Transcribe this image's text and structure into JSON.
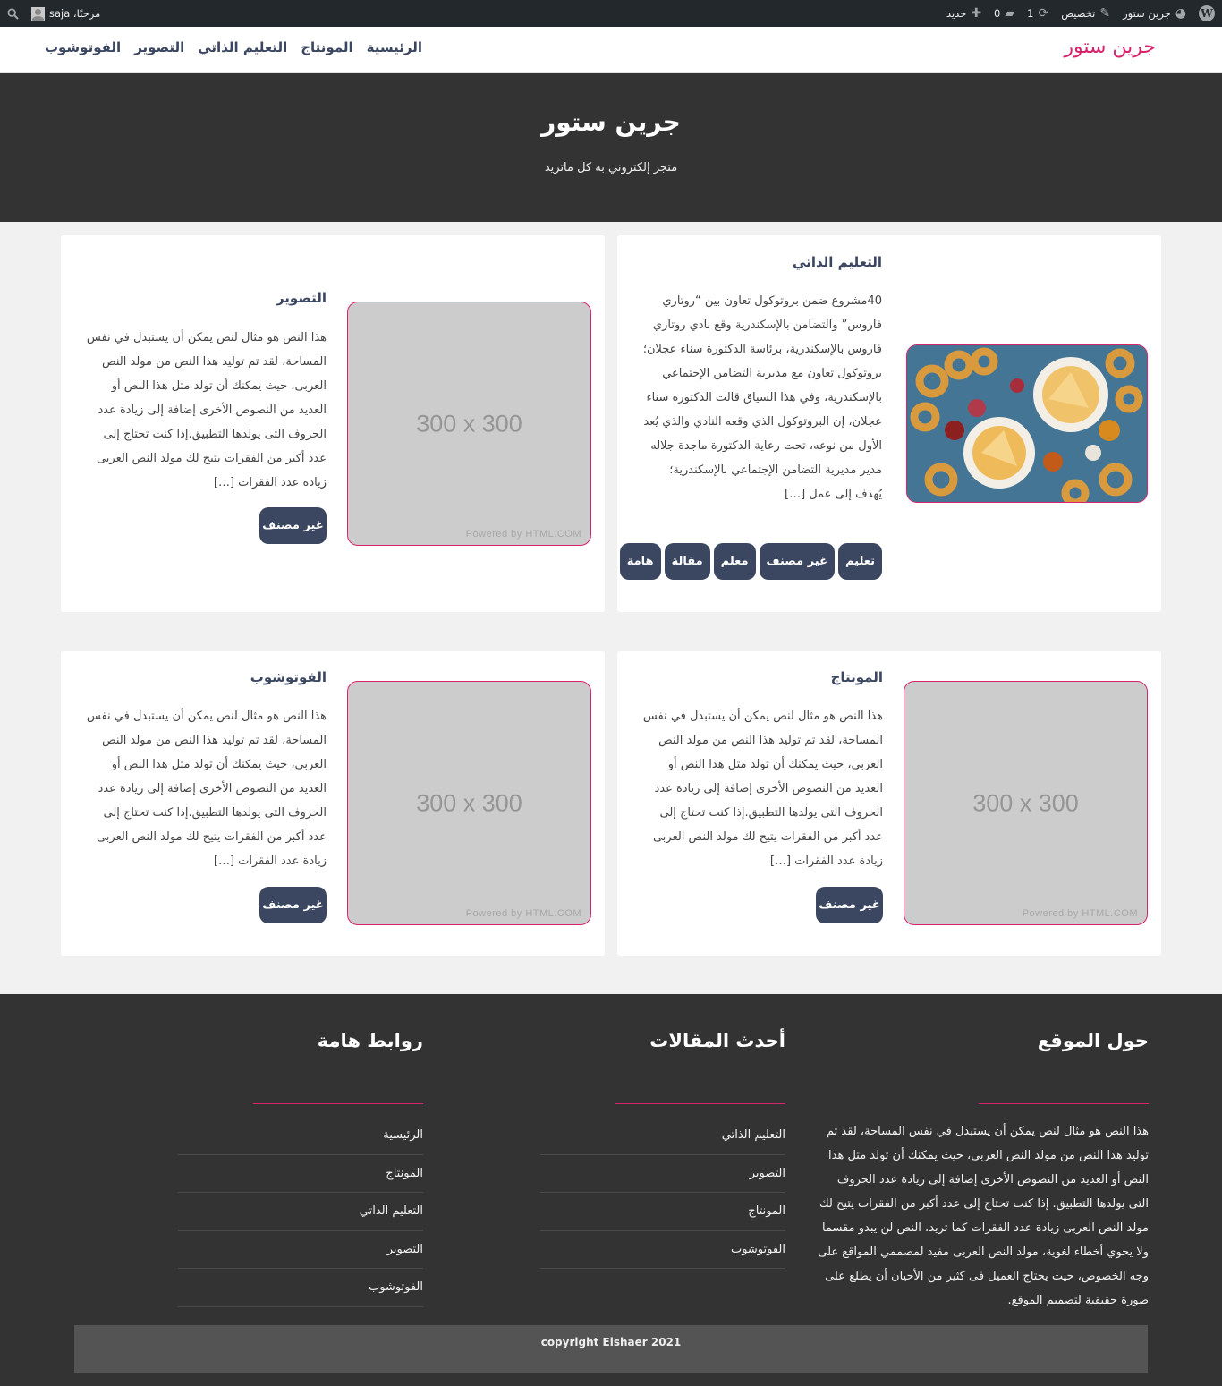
{
  "adminbar": {
    "site_name": "جرين ستور",
    "customize_label": "تخصيص",
    "updates_count": "1",
    "comments_count": "0",
    "new_label": "جديد",
    "greeting": "مرحبًا، saja"
  },
  "header": {
    "brand": "جرين ستور",
    "nav": [
      "الرئيسية",
      "المونتاج",
      "التعليم الذاتي",
      "التصوير",
      "الفوتوشوب"
    ]
  },
  "hero": {
    "title": "جرين ستور",
    "subtitle": "متجر إلكتروني به كل ماتريد"
  },
  "placeholder": {
    "size": "300 x 300",
    "note": "Powered by HTML.COM"
  },
  "posts": [
    {
      "title": "التعليم الذاتي",
      "excerpt": "40مشروع ضمن بروتوكول تعاون بين “روتاري فاروس” والتضامن بالإسكندرية وقع نادي روتاري فاروس بالإسكندرية، برئاسة الدكتورة سناء عجلان؛ بروتوكول تعاون مع مديرية التضامن الإجتماعي بالإسكندرية، وفي هذا السياق قالت الدكتورة سناء عجلان، إن البروتوكول الذي وقعه النادي والذي يُعد الأول من نوعه، تحت رعاية الدكتورة ماجدة جلاله مدير مديرية التضامن الإجتماعي بالإسكندرية؛ يُهدف إلى عمل […]",
      "tags": [
        "تعليم",
        "غير مصنف",
        "معلم",
        "مقالة",
        "هامة"
      ]
    },
    {
      "title": "التصوير",
      "excerpt": "هذا النص هو مثال لنص يمكن أن يستبدل في نفس المساحة، لقد تم توليد هذا النص من مولد النص العربى، حيث يمكنك أن تولد مثل هذا النص أو العديد من النصوص الأخرى إضافة إلى زيادة عدد الحروف التى يولدها التطبيق.إذا كنت تحتاج إلى عدد أكبر من الفقرات يتيح لك مولد النص العربى زيادة عدد الفقرات […]",
      "tags": [
        "غير مصنف"
      ]
    },
    {
      "title": "المونتاج",
      "excerpt": "هذا النص هو مثال لنص يمكن أن يستبدل في نفس المساحة، لقد تم توليد هذا النص من مولد النص العربى، حيث يمكنك أن تولد مثل هذا النص أو العديد من النصوص الأخرى إضافة إلى زيادة عدد الحروف التى يولدها التطبيق.إذا كنت تحتاج إلى عدد أكبر من الفقرات يتيح لك مولد النص العربى زيادة عدد الفقرات […]",
      "tags": [
        "غير مصنف"
      ]
    },
    {
      "title": "الفوتوشوب",
      "excerpt": "هذا النص هو مثال لنص يمكن أن يستبدل في نفس المساحة، لقد تم توليد هذا النص من مولد النص العربى، حيث يمكنك أن تولد مثل هذا النص أو العديد من النصوص الأخرى إضافة إلى زيادة عدد الحروف التى يولدها التطبيق.إذا كنت تحتاج إلى عدد أكبر من الفقرات يتيح لك مولد النص العربى زيادة عدد الفقرات […]",
      "tags": [
        "غير مصنف"
      ]
    }
  ],
  "footer": {
    "about_title": "حول الموقع",
    "about_text": "هذا النص هو مثال لنص يمكن أن يستبدل في نفس المساحة، لقد تم توليد هذا النص من مولد النص العربى، حيث يمكنك أن تولد مثل هذا النص أو العديد من النصوص الأخرى إضافة إلى زيادة عدد الحروف التى يولدها التطبيق. إذا كنت تحتاج إلى عدد أكبر من الفقرات يتيح لك مولد النص العربى زيادة عدد الفقرات كما تريد، النص لن يبدو مقسما ولا يحوي أخطاء لغوية، مولد النص العربى مفيد لمصممي المواقع على وجه الخصوص، حيث يحتاج العميل فى كثير من الأحيان أن يطلع على صورة حقيقية لتصميم الموقع.",
    "recent_title": "أحدث المقالات",
    "recent": [
      "التعليم الذاتي",
      "التصوير",
      "المونتاج",
      "الفوتوشوب"
    ],
    "links_title": "روابط هامة",
    "links": [
      "الرئيسية",
      "المونتاج",
      "التعليم الذاتي",
      "التصوير",
      "الفوتوشوب"
    ],
    "copyright": "copyright Elshaer 2021"
  },
  "colors": {
    "accent": "#d9226c",
    "button": "#3b4660",
    "dark": "#333333",
    "adminbar": "#23282d"
  }
}
